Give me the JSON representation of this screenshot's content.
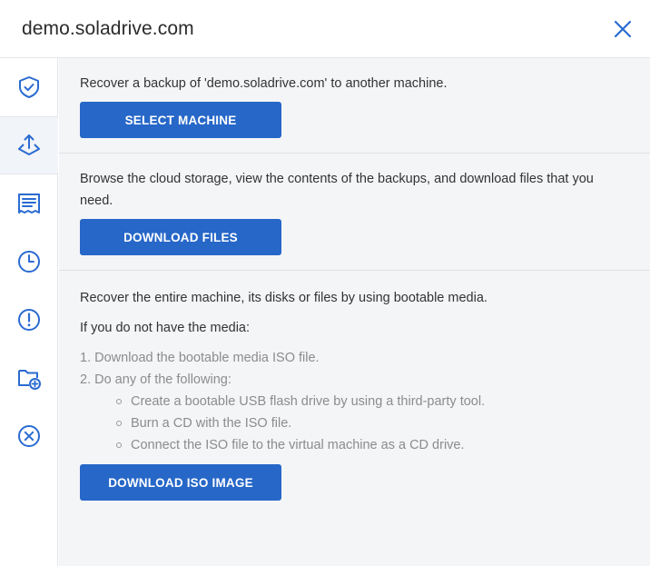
{
  "header": {
    "title": "demo.soladrive.com"
  },
  "sidebar": {
    "items": [
      {
        "icon": "shield-check-icon"
      },
      {
        "icon": "recovery-arrows-icon",
        "active": true
      },
      {
        "icon": "report-list-icon"
      },
      {
        "icon": "clock-icon"
      },
      {
        "icon": "alert-circle-icon"
      },
      {
        "icon": "folder-add-icon"
      },
      {
        "icon": "close-circle-icon"
      }
    ]
  },
  "main": {
    "recover_machine": {
      "text": "Recover a backup of 'demo.soladrive.com' to another machine.",
      "button": "SELECT MACHINE"
    },
    "download_files": {
      "text": "Browse the cloud storage, view the contents of the backups, and download files that you need.",
      "button": "DOWNLOAD FILES"
    },
    "bootable_media": {
      "text": "Recover the entire machine, its disks or files by using bootable media.",
      "if_no_media": "If you do not have the media:",
      "steps": [
        "1. Download the bootable media ISO file.",
        "2. Do any of the following:"
      ],
      "options": [
        "Create a bootable USB flash drive by using a third-party tool.",
        "Burn a CD with the ISO file.",
        "Connect the ISO file to the virtual machine as a CD drive."
      ],
      "button": "DOWNLOAD ISO IMAGE"
    }
  },
  "colors": {
    "accent": "#2667c8",
    "icon": "#2a6bd1",
    "muted": "#8c8c8c"
  }
}
